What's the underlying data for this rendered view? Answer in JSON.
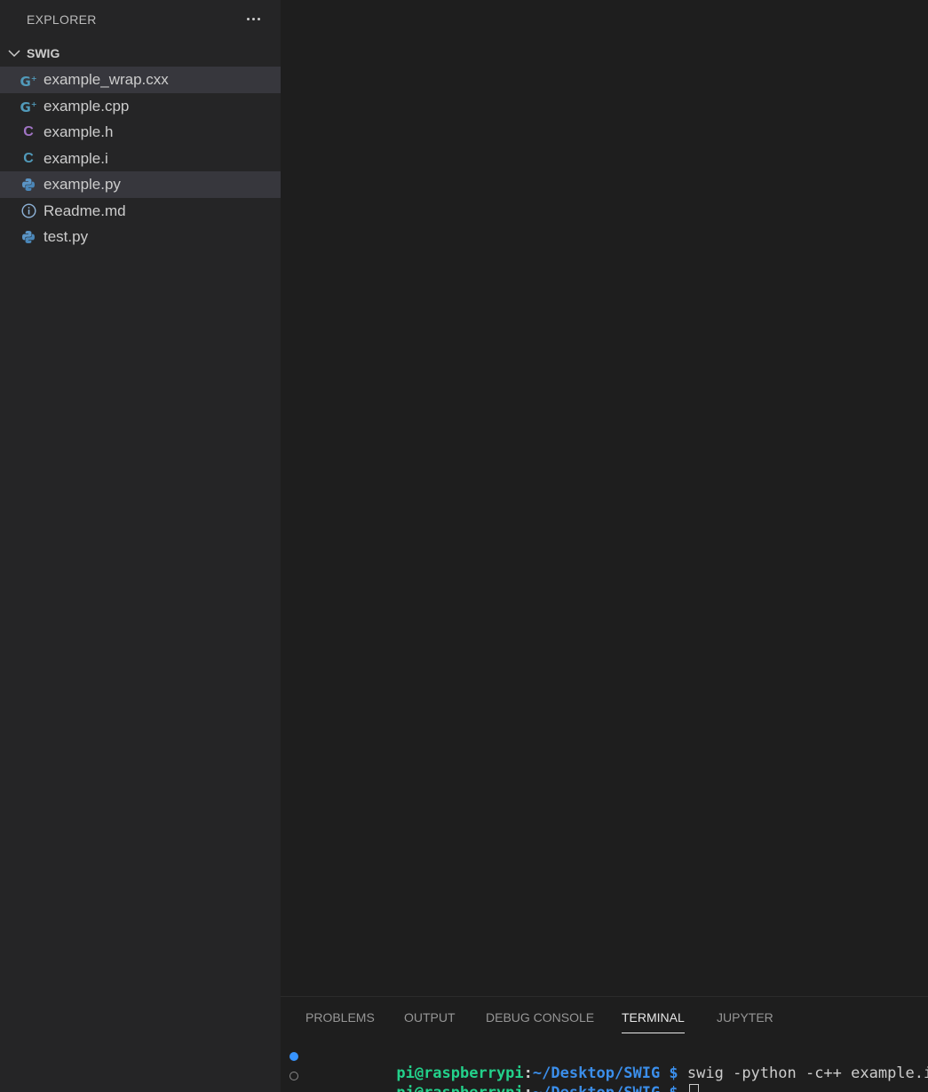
{
  "sidebar": {
    "title": "EXPLORER",
    "more_icon": "ellipsis-icon",
    "folder": {
      "name": "SWIG",
      "expanded": true
    },
    "files": [
      {
        "name": "example_wrap.cxx",
        "icon": "cpp-file-icon",
        "selected": true
      },
      {
        "name": "example.cpp",
        "icon": "cpp-file-icon",
        "selected": false
      },
      {
        "name": "example.h",
        "icon": "c-header-file-icon",
        "selected": false
      },
      {
        "name": "example.i",
        "icon": "c-file-icon",
        "selected": false
      },
      {
        "name": "example.py",
        "icon": "python-file-icon",
        "selected": true
      },
      {
        "name": "Readme.md",
        "icon": "info-icon",
        "selected": false
      },
      {
        "name": "test.py",
        "icon": "python-file-icon",
        "selected": false
      }
    ]
  },
  "panel": {
    "tabs": [
      {
        "label": "PROBLEMS"
      },
      {
        "label": "OUTPUT"
      },
      {
        "label": "DEBUG CONSOLE"
      },
      {
        "label": "TERMINAL",
        "active": true
      },
      {
        "label": "JUPYTER"
      }
    ],
    "terminal": {
      "lines": [
        {
          "user": "pi@raspberrypi",
          "colon": ":",
          "path": "~/Desktop/SWIG $",
          "command": " swig -python -c++ example.i"
        },
        {
          "user": "pi@raspberrypi",
          "colon": ":",
          "path": "~/Desktop/SWIG $",
          "command": " "
        }
      ]
    }
  },
  "colors": {
    "sidebar_bg": "#252526",
    "editor_bg": "#1e1e1e",
    "selection_bg": "#37373d",
    "terminal_user": "#23d18b",
    "terminal_path": "#3b8eea"
  }
}
